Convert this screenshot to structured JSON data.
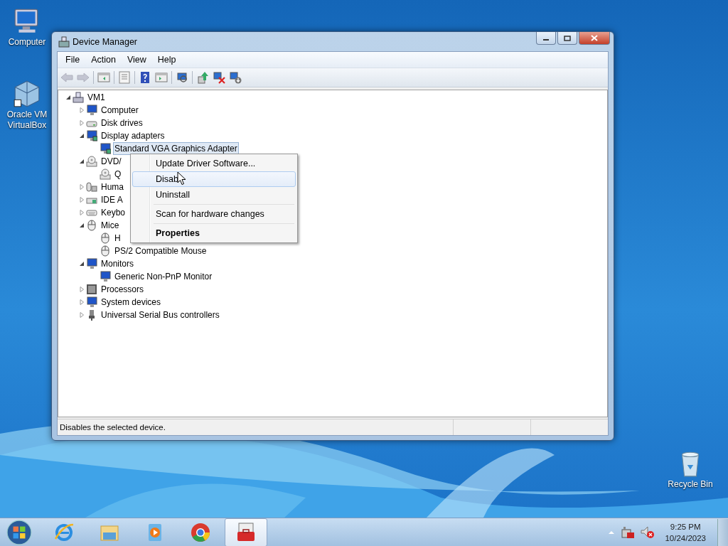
{
  "desktop_icons": [
    {
      "label": "Computer",
      "kind": "computer"
    },
    {
      "label": "Oracle VM VirtualBox",
      "kind": "virtualbox"
    },
    {
      "label": "Recycle Bin",
      "kind": "recycle"
    }
  ],
  "window": {
    "title": "Device Manager",
    "menu": [
      "File",
      "Action",
      "View",
      "Help"
    ],
    "toolbar": [
      {
        "kind": "back",
        "disabled": true
      },
      {
        "kind": "forward",
        "disabled": true
      },
      {
        "kind": "sep"
      },
      {
        "kind": "tree",
        "disabled": false
      },
      {
        "kind": "sep"
      },
      {
        "kind": "properties",
        "disabled": false
      },
      {
        "kind": "sep"
      },
      {
        "kind": "help",
        "disabled": false
      },
      {
        "kind": "pane",
        "disabled": false
      },
      {
        "kind": "sep"
      },
      {
        "kind": "scan",
        "disabled": false
      },
      {
        "kind": "sep"
      },
      {
        "kind": "update",
        "disabled": false
      },
      {
        "kind": "uninstall",
        "disabled": false
      },
      {
        "kind": "enable",
        "disabled": false
      }
    ],
    "tree": {
      "label": "VM1",
      "kind": "computer",
      "expanded": true,
      "selected": false,
      "children": [
        {
          "label": "Computer",
          "kind": "monitor",
          "expanded": false,
          "selected": false
        },
        {
          "label": "Disk drives",
          "kind": "disk",
          "expanded": false,
          "selected": false
        },
        {
          "label": "Display adapters",
          "kind": "display",
          "expanded": true,
          "selected": false,
          "children": [
            {
              "label": "Standard VGA Graphics Adapter",
              "kind": "display",
              "selected": true
            }
          ]
        },
        {
          "label": "DVD/",
          "kind": "dvd",
          "expanded": true,
          "selected": false,
          "children": [
            {
              "label": "Q",
              "kind": "dvd",
              "selected": false
            }
          ]
        },
        {
          "label": "Huma",
          "kind": "hid",
          "expanded": false,
          "selected": false
        },
        {
          "label": "IDE A",
          "kind": "ide",
          "expanded": false,
          "selected": false
        },
        {
          "label": "Keybo",
          "kind": "keyboard",
          "expanded": false,
          "selected": false
        },
        {
          "label": "Mice",
          "kind": "mouse",
          "expanded": true,
          "selected": false,
          "children": [
            {
              "label": "H",
              "kind": "mouse",
              "selected": false
            },
            {
              "label": "PS/2 Compatible Mouse",
              "kind": "mouse",
              "selected": false
            }
          ]
        },
        {
          "label": "Monitors",
          "kind": "monitor",
          "expanded": true,
          "selected": false,
          "children": [
            {
              "label": "Generic Non-PnP Monitor",
              "kind": "monitor",
              "selected": false
            }
          ]
        },
        {
          "label": "Processors",
          "kind": "processor",
          "expanded": false,
          "selected": false
        },
        {
          "label": "System devices",
          "kind": "monitor",
          "expanded": false,
          "selected": false
        },
        {
          "label": "Universal Serial Bus controllers",
          "kind": "usb",
          "expanded": false,
          "selected": false
        }
      ]
    },
    "context_menu": [
      {
        "label": "Update Driver Software...",
        "selected": false,
        "default": false,
        "separator_before": false
      },
      {
        "label": "Disab",
        "selected": true,
        "default": false,
        "separator_before": false
      },
      {
        "label": "Uninstall",
        "selected": false,
        "default": false,
        "separator_before": false
      },
      {
        "label": "Scan for hardware changes",
        "selected": false,
        "default": false,
        "separator_before": true
      },
      {
        "label": "Properties",
        "selected": false,
        "default": true,
        "separator_before": true
      }
    ],
    "status_bar": "Disables the selected device."
  },
  "taskbar": {
    "apps": [
      {
        "kind": "ie",
        "selected": false
      },
      {
        "kind": "explorer",
        "selected": false
      },
      {
        "kind": "media",
        "selected": false
      },
      {
        "kind": "chrome",
        "selected": false
      },
      {
        "kind": "devmgr",
        "selected": true
      }
    ],
    "time": "9:25 PM",
    "date": "10/24/2023"
  }
}
